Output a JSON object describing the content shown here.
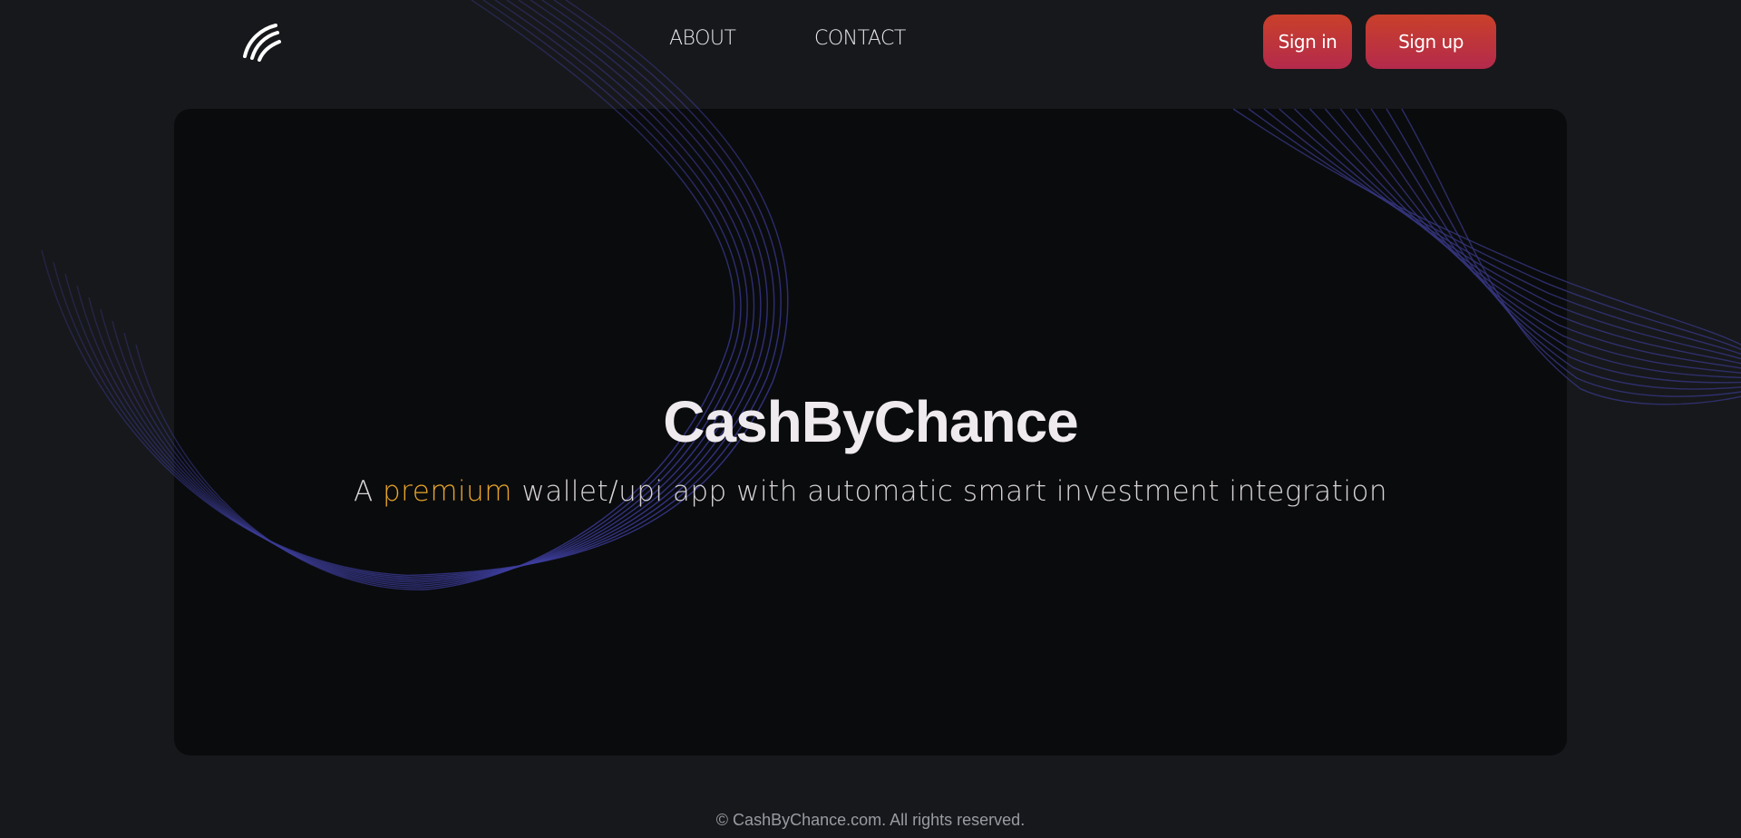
{
  "header": {
    "logo_icon": "brand-logo-icon",
    "nav": [
      {
        "label": "ABOUT"
      },
      {
        "label": "CONTACT"
      }
    ],
    "sign_in_label": "Sign in",
    "sign_up_label": "Sign up"
  },
  "hero": {
    "title": "CashByChance",
    "subtitle_prefix": "A ",
    "subtitle_highlight": "premium",
    "subtitle_suffix": " wallet/upi app with automatic smart investment integration"
  },
  "footer": {
    "copyright": "© CashByChance.com. All rights reserved."
  },
  "colors": {
    "background": "#17181b",
    "card": "#0a0b0d",
    "highlight": "#e9a52b",
    "button_gradient_start": "#c9402a",
    "button_gradient_end": "#b42a4c",
    "wave": "#3a3a9a"
  }
}
